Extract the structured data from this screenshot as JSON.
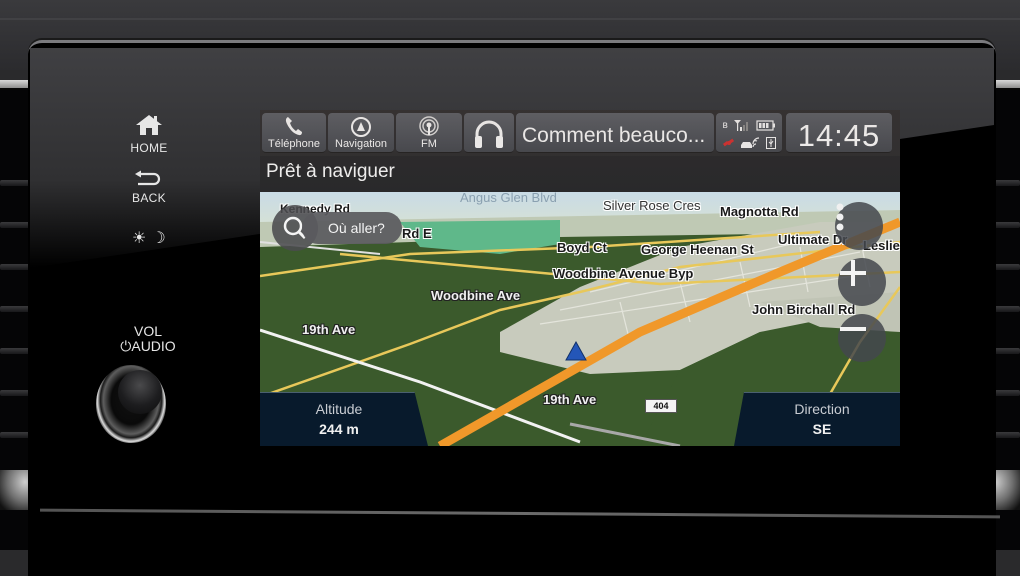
{
  "hard_buttons": {
    "home_label": "HOME",
    "back_label": "BACK",
    "day_icon": "☀",
    "night_icon": "☽",
    "vol_label": "VOL",
    "audio_label": "AUDIO",
    "power_icon": "⏻"
  },
  "topbar": {
    "tabs": [
      {
        "label": "Téléphone",
        "icon": "phone-icon"
      },
      {
        "label": "Navigation",
        "icon": "navigation-icon"
      },
      {
        "label": "FM",
        "icon": "radio-icon"
      },
      {
        "label": "",
        "icon": "headphones-icon"
      }
    ],
    "media_text": "Comment beauco...",
    "status_icons": [
      "bluetooth-icon",
      "signal-icon",
      "battery-icon",
      "satellite-icon",
      "car-wifi-icon",
      "usb-icon"
    ],
    "clock": "14:45"
  },
  "nav": {
    "status": "Prêt à naviguer",
    "search_placeholder": "Où aller?",
    "route_shield": "404",
    "streets": [
      "Angus Glen Blvd",
      "Kennedy Rd",
      "Rd E",
      "Silver Rose Cres",
      "Magnotta Rd",
      "Boyd Ct",
      "George Heenan St",
      "Ultimate Dr",
      "Leslie",
      "Woodbine Avenue Byp",
      "Woodbine Ave",
      "John Birchall Rd",
      "19th Ave",
      "19th Ave"
    ],
    "altitude_label": "Altitude",
    "altitude_value": "244 m",
    "direction_label": "Direction",
    "direction_value": "SE"
  },
  "colors": {
    "highway": "#f0982a",
    "road_yellow": "#e8c85a",
    "farmland": "#3b5a2c",
    "urban": "#c8cbbd",
    "info_panel": "#081a2c",
    "position_marker": "#2456b8"
  }
}
